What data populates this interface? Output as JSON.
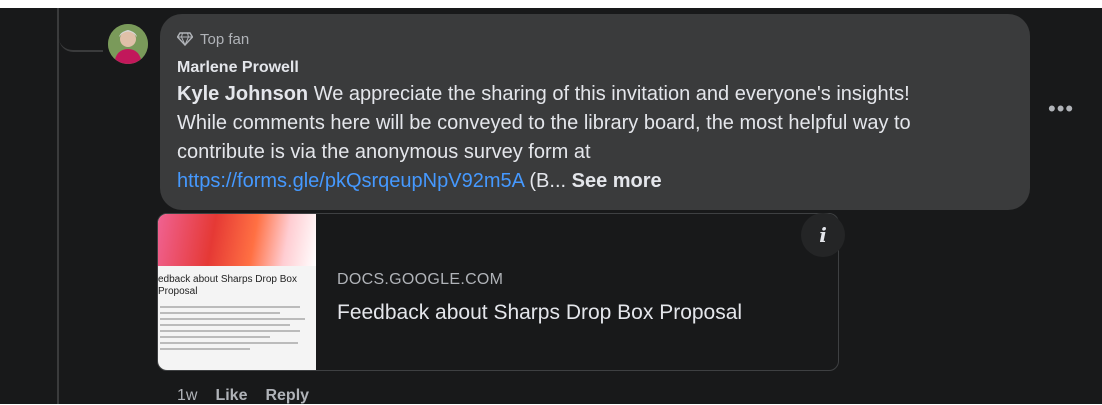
{
  "comment": {
    "badge_label": "Top fan",
    "badge_icon": "diamond-icon",
    "author": "Marlene Prowell",
    "mention": "Kyle Johnson",
    "text_line1": " We appreciate the sharing of this invitation and everyone's insights!",
    "text_line2": "While comments here will be conveyed to the library board, the most helpful way to",
    "text_line3": "contribute is via the anonymous survey form at",
    "link": "https://forms.gle/pkQsrqeupNpV92m5A",
    "link_suffix": " (B...",
    "see_more": " See more",
    "more_icon": "more-options-icon"
  },
  "link_card": {
    "domain": "DOCS.GOOGLE.COM",
    "title": "Feedback about Sharps Drop Box Proposal",
    "thumb_title": "edback about Sharps Drop Box Proposal",
    "info_icon": "info-icon"
  },
  "actions": {
    "time": "1w",
    "like": "Like",
    "reply": "Reply"
  },
  "colors": {
    "background": "#18191a",
    "bubble": "#3a3b3c",
    "link": "#4599ff",
    "text": "#e4e6eb",
    "muted": "#b0b3b8"
  }
}
